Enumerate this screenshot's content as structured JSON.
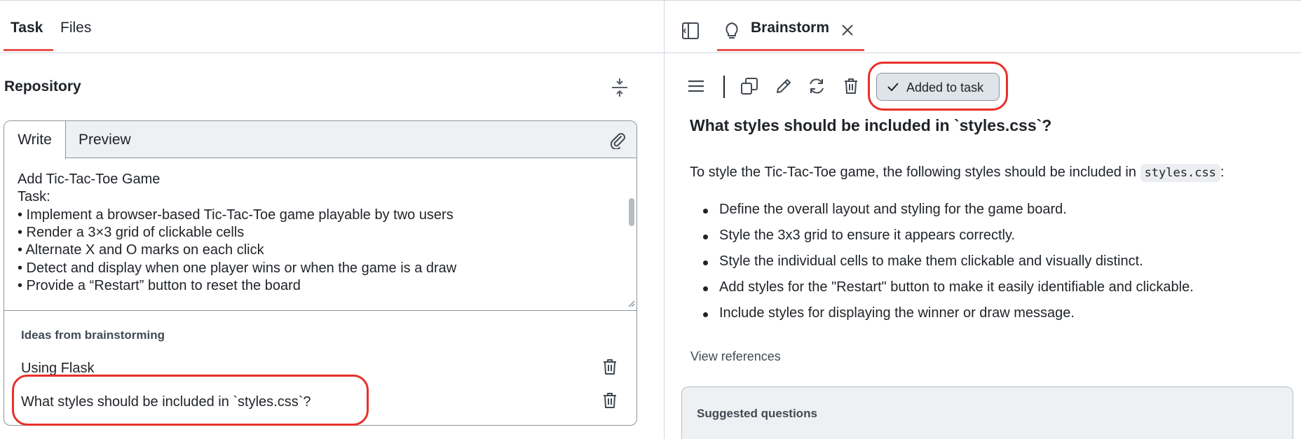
{
  "left_tabs": {
    "task": "Task",
    "files": "Files"
  },
  "repository": {
    "title": "Repository"
  },
  "editor": {
    "tabs": {
      "write": "Write",
      "preview": "Preview"
    },
    "lines": [
      "Add Tic-Tac-Toe Game",
      "Task:",
      "  • Implement a browser-based Tic-Tac-Toe game playable by two users",
      "  • Render a 3×3 grid of clickable cells",
      "  • Alternate X and O marks on each click",
      "  • Detect and display when one player wins or when the game is a draw",
      "  • Provide a “Restart” button to reset the board"
    ]
  },
  "ideas": {
    "title": "Ideas from brainstorming",
    "items": [
      "Using Flask",
      "What styles should be included in `styles.css`?"
    ]
  },
  "right_tab": {
    "label": "Brainstorm"
  },
  "toolbar": {
    "added_label": "Added to task"
  },
  "answer": {
    "title": "What styles should be included in `styles.css`?",
    "intro_before": "To style the Tic-Tac-Toe game, the following styles should be included in ",
    "intro_code": "styles.css",
    "intro_after": ":",
    "bullets": [
      "Define the overall layout and styling for the game board.",
      "Style the 3x3 grid to ensure it appears correctly.",
      "Style the individual cells to make them clickable and visually distinct.",
      "Add styles for the \"Restart\" button to make it easily identifiable and clickable.",
      "Include styles for displaying the winner or draw message."
    ],
    "view_references": "View references"
  },
  "suggested": {
    "title": "Suggested questions"
  },
  "colors": {
    "accent": "#e5534b",
    "highlight": "#e8302a",
    "button_bg": "#dfe4ea"
  },
  "icons": [
    "collapse-icon",
    "paperclip-icon",
    "trash-icon",
    "sidebar-toggle-icon",
    "lightbulb-icon",
    "close-icon",
    "menu-icon",
    "copy-icon",
    "pencil-icon",
    "refresh-icon",
    "check-icon"
  ]
}
